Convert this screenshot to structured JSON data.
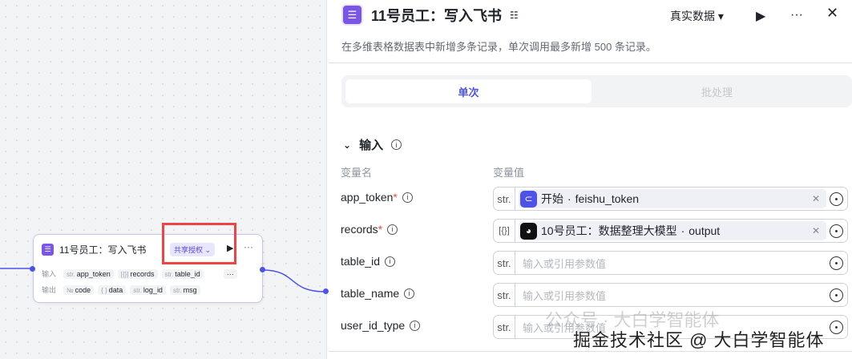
{
  "canvas_node": {
    "title": "11号员工：写入飞书",
    "share_label": "共享授权",
    "input_label": "输入",
    "output_label": "输出",
    "inputs": [
      {
        "type": "str.",
        "name": "app_token"
      },
      {
        "type": "[{}]",
        "name": "records"
      },
      {
        "type": "str.",
        "name": "table_id"
      }
    ],
    "more": "···",
    "outputs": [
      {
        "type": "№",
        "name": "code"
      },
      {
        "type": "{ }",
        "name": "data"
      },
      {
        "type": "str.",
        "name": "log_id"
      },
      {
        "type": "str.",
        "name": "msg"
      }
    ]
  },
  "panel": {
    "title": "11号员工：写入飞书",
    "description": "在多维表格数据表中新增多条记录，单次调用最多新增 500 条记录。",
    "data_mode": "真实数据 ▾",
    "tabs": [
      {
        "label": "单次"
      },
      {
        "label": "批处理"
      }
    ],
    "section": "输入",
    "col_name": "变量名",
    "col_value": "变量值",
    "params": [
      {
        "name": "app_token",
        "required": "*",
        "type": "str.",
        "ref_node": "开始",
        "ref_var": "feishu_token"
      },
      {
        "name": "records",
        "required": "*",
        "type": "[{}]",
        "ref_node": "10号员工：数据整理大模型",
        "ref_var": "output"
      },
      {
        "name": "table_id",
        "type": "str.",
        "placeholder": "输入或引用参数值"
      },
      {
        "name": "table_name",
        "type": "str.",
        "placeholder": "输入或引用参数值"
      },
      {
        "name": "user_id_type",
        "type": "str.",
        "placeholder": "输入或引用参数值"
      }
    ]
  },
  "watermark": {
    "line1": "公众号 · 大白学智能体",
    "line2": "掘金技术社区 @ 大白学智能体"
  },
  "colors": {
    "accent": "#4d53e8",
    "node_icon": "#7b55e6",
    "highlight": "#ef4444"
  }
}
